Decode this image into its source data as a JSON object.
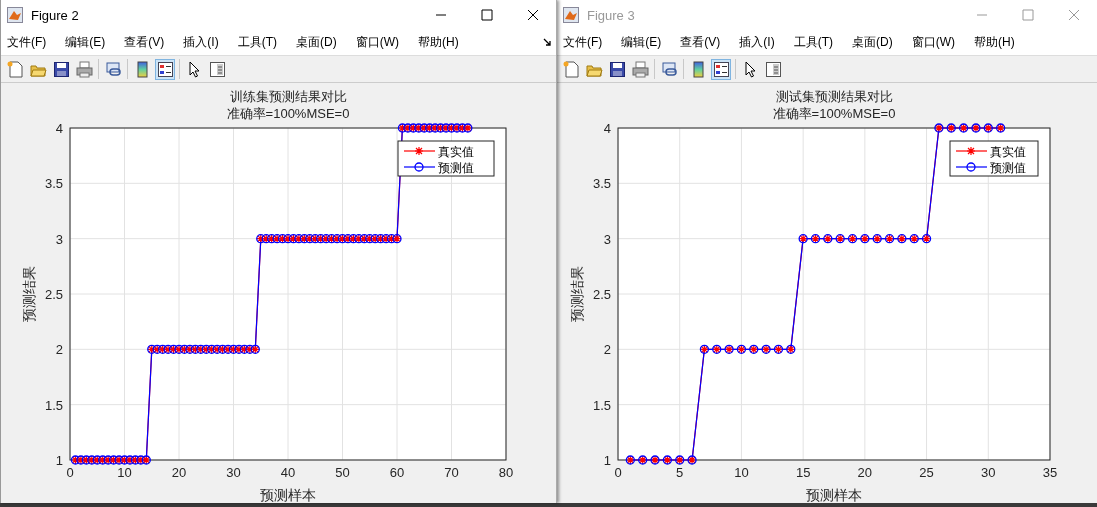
{
  "windows": [
    {
      "title": "Figure 2",
      "active": true,
      "menu": [
        "文件(F)",
        "编辑(E)",
        "查看(V)",
        "插入(I)",
        "工具(T)",
        "桌面(D)",
        "窗口(W)",
        "帮助(H)"
      ],
      "toolbar": [
        [
          {
            "kind": "new",
            "selected": false
          },
          {
            "kind": "open",
            "selected": false
          },
          {
            "kind": "save",
            "selected": false
          },
          {
            "kind": "print",
            "selected": false
          }
        ],
        [
          {
            "kind": "link",
            "selected": false
          }
        ],
        [
          {
            "kind": "colorbar",
            "selected": false
          },
          {
            "kind": "legend",
            "selected": true
          }
        ],
        [
          {
            "kind": "pointer",
            "selected": false
          },
          {
            "kind": "panel",
            "selected": false
          }
        ]
      ],
      "chart_data": {
        "type": "line",
        "title": "训练集预测结果对比",
        "subtitle": "准确率=100%MSE=0",
        "xlabel": "预测样本",
        "ylabel": "预测结果",
        "x": [
          1,
          2,
          3,
          4,
          5,
          6,
          7,
          8,
          9,
          10,
          11,
          12,
          13,
          14,
          15,
          16,
          17,
          18,
          19,
          20,
          21,
          22,
          23,
          24,
          25,
          26,
          27,
          28,
          29,
          30,
          31,
          32,
          33,
          34,
          35,
          36,
          37,
          38,
          39,
          40,
          41,
          42,
          43,
          44,
          45,
          46,
          47,
          48,
          49,
          50,
          51,
          52,
          53,
          54,
          55,
          56,
          57,
          58,
          59,
          60,
          61,
          62,
          63,
          64,
          65,
          66,
          67,
          68,
          69,
          70,
          71,
          72,
          73
        ],
        "series": [
          {
            "name": "真实值",
            "color": "#ff0000",
            "marker": "cross",
            "values": [
              1,
              1,
              1,
              1,
              1,
              1,
              1,
              1,
              1,
              1,
              1,
              1,
              1,
              1,
              2,
              2,
              2,
              2,
              2,
              2,
              2,
              2,
              2,
              2,
              2,
              2,
              2,
              2,
              2,
              2,
              2,
              2,
              2,
              2,
              3,
              3,
              3,
              3,
              3,
              3,
              3,
              3,
              3,
              3,
              3,
              3,
              3,
              3,
              3,
              3,
              3,
              3,
              3,
              3,
              3,
              3,
              3,
              3,
              3,
              3,
              4,
              4,
              4,
              4,
              4,
              4,
              4,
              4,
              4,
              4,
              4,
              4,
              4
            ]
          },
          {
            "name": "预测值",
            "color": "#0000ff",
            "marker": "circle",
            "values": [
              1,
              1,
              1,
              1,
              1,
              1,
              1,
              1,
              1,
              1,
              1,
              1,
              1,
              1,
              2,
              2,
              2,
              2,
              2,
              2,
              2,
              2,
              2,
              2,
              2,
              2,
              2,
              2,
              2,
              2,
              2,
              2,
              2,
              2,
              3,
              3,
              3,
              3,
              3,
              3,
              3,
              3,
              3,
              3,
              3,
              3,
              3,
              3,
              3,
              3,
              3,
              3,
              3,
              3,
              3,
              3,
              3,
              3,
              3,
              3,
              4,
              4,
              4,
              4,
              4,
              4,
              4,
              4,
              4,
              4,
              4,
              4,
              4
            ]
          }
        ],
        "xlim": [
          0,
          80
        ],
        "ylim": [
          1,
          4
        ],
        "grid": true,
        "legend": true,
        "xticks": [
          0,
          10,
          20,
          30,
          40,
          50,
          60,
          70,
          80
        ],
        "yticks": [
          1,
          1.5,
          2,
          2.5,
          3,
          3.5,
          4
        ]
      }
    },
    {
      "title": "Figure 3",
      "active": false,
      "menu": [
        "文件(F)",
        "编辑(E)",
        "查看(V)",
        "插入(I)",
        "工具(T)",
        "桌面(D)",
        "窗口(W)",
        "帮助(H)"
      ],
      "toolbar": [
        [
          {
            "kind": "new",
            "selected": false
          },
          {
            "kind": "open",
            "selected": false
          },
          {
            "kind": "save",
            "selected": false
          },
          {
            "kind": "print",
            "selected": false
          }
        ],
        [
          {
            "kind": "link",
            "selected": false
          }
        ],
        [
          {
            "kind": "colorbar",
            "selected": false
          },
          {
            "kind": "legend",
            "selected": true
          }
        ],
        [
          {
            "kind": "pointer",
            "selected": false
          },
          {
            "kind": "panel",
            "selected": false
          }
        ]
      ],
      "chart_data": {
        "type": "line",
        "title": "测试集预测结果对比",
        "subtitle": "准确率=100%MSE=0",
        "xlabel": "预测样本",
        "ylabel": "预测结果",
        "x": [
          1,
          2,
          3,
          4,
          5,
          6,
          7,
          8,
          9,
          10,
          11,
          12,
          13,
          14,
          15,
          16,
          17,
          18,
          19,
          20,
          21,
          22,
          23,
          24,
          25,
          26,
          27,
          28,
          29,
          30,
          31
        ],
        "series": [
          {
            "name": "真实值",
            "color": "#ff0000",
            "marker": "cross",
            "values": [
              1,
              1,
              1,
              1,
              1,
              1,
              2,
              2,
              2,
              2,
              2,
              2,
              2,
              2,
              3,
              3,
              3,
              3,
              3,
              3,
              3,
              3,
              3,
              3,
              3,
              4,
              4,
              4,
              4,
              4,
              4
            ]
          },
          {
            "name": "预测值",
            "color": "#0000ff",
            "marker": "circle",
            "values": [
              1,
              1,
              1,
              1,
              1,
              1,
              2,
              2,
              2,
              2,
              2,
              2,
              2,
              2,
              3,
              3,
              3,
              3,
              3,
              3,
              3,
              3,
              3,
              3,
              3,
              4,
              4,
              4,
              4,
              4,
              4
            ]
          }
        ],
        "xlim": [
          0,
          35
        ],
        "ylim": [
          1,
          4
        ],
        "grid": true,
        "legend": true,
        "xticks": [
          0,
          5,
          10,
          15,
          20,
          25,
          30,
          35
        ],
        "yticks": [
          1,
          1.5,
          2,
          2.5,
          3,
          3.5,
          4
        ]
      }
    }
  ]
}
